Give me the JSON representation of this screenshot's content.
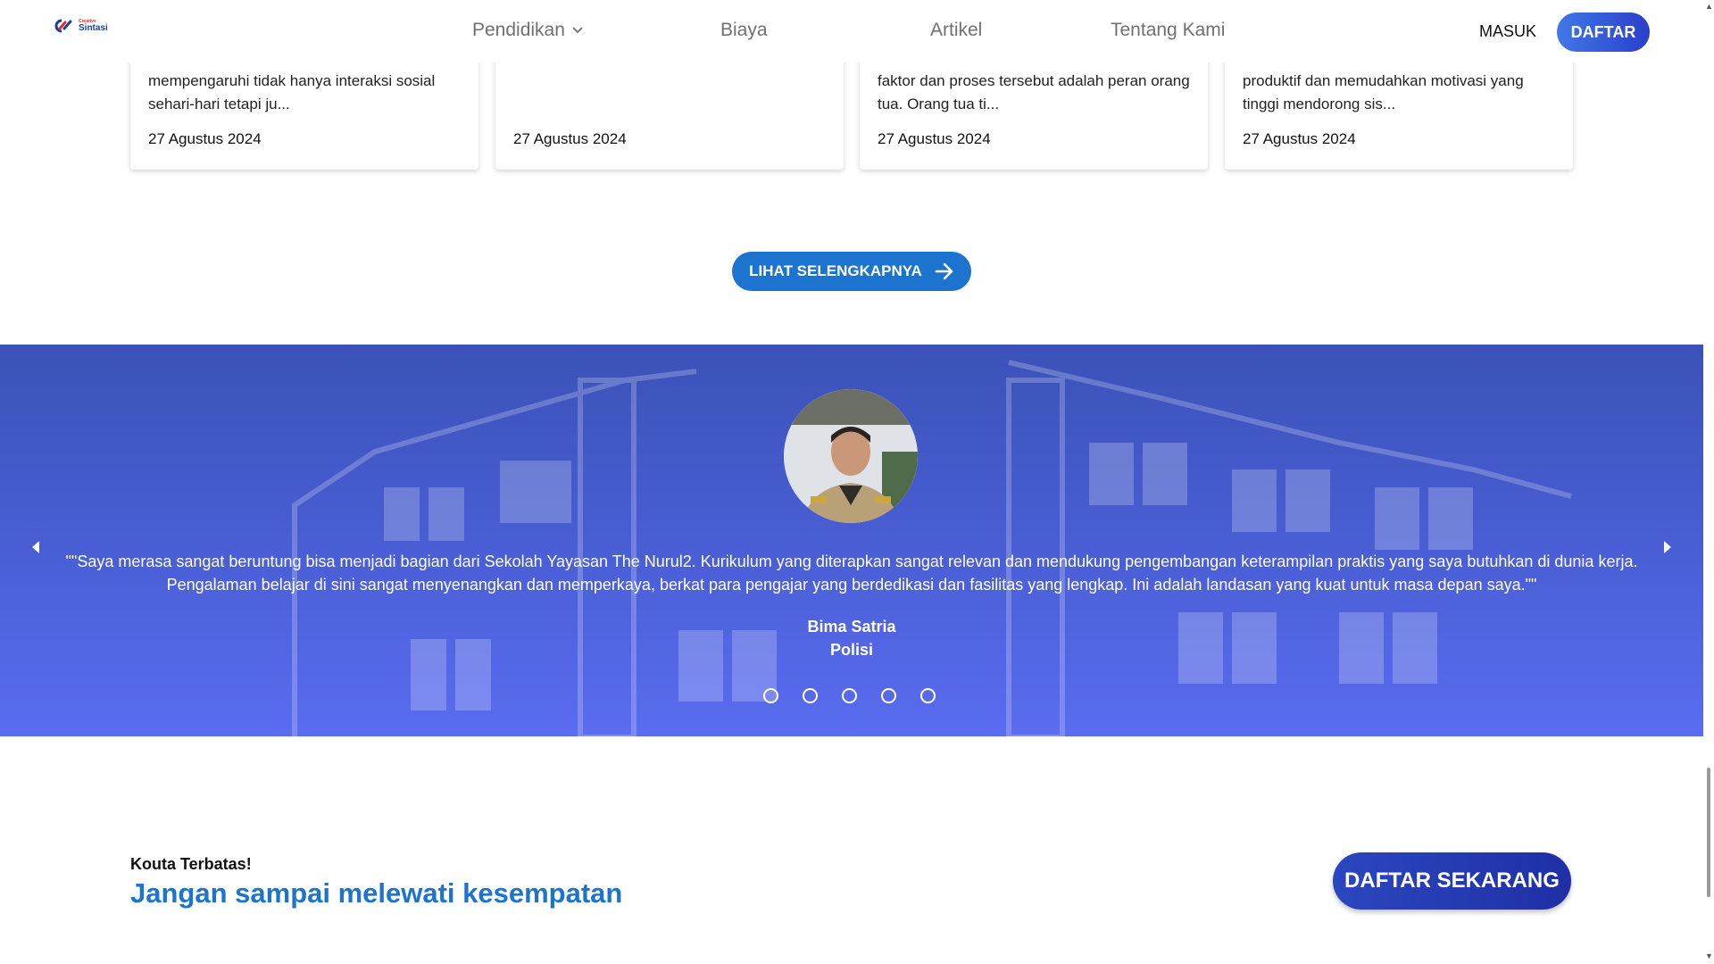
{
  "header": {
    "logo_small": "Creative",
    "logo_big": "Sintasi",
    "nav": [
      {
        "label": "Pendidikan",
        "has_dropdown": true
      },
      {
        "label": "Biaya"
      },
      {
        "label": "Artikel"
      },
      {
        "label": "Tentang Kami"
      }
    ],
    "masuk_label": "MASUK",
    "daftar_label": "DAFTAR"
  },
  "articles": [
    {
      "excerpt": "mempengaruhi tidak hanya interaksi sosial sehari-hari tetapi ju...",
      "date": "27 Agustus 2024"
    },
    {
      "excerpt": "",
      "date": "27 Agustus 2024"
    },
    {
      "excerpt": "faktor dan proses tersebut adalah peran orang tua. Orang tua ti...",
      "date": "27 Agustus 2024"
    },
    {
      "excerpt": "produktif dan memudahkan motivasi yang tinggi mendorong sis...",
      "date": "27 Agustus 2024"
    }
  ],
  "see_more_label": "LIHAT SELENGKAPNYA",
  "testimonial": {
    "quote_line1": "\"\"Saya merasa sangat beruntung bisa menjadi bagian dari Sekolah Yayasan The Nurul2. Kurikulum yang diterapkan sangat relevan dan mendukung pengembangan keterampilan praktis yang saya butuhkan di dunia kerja.",
    "quote_line2": "Pengalaman belajar di sini sangat menyenangkan dan memperkaya, berkat para pengajar yang berdedikasi dan fasilitas yang lengkap. Ini adalah landasan yang kuat untuk masa depan saya.\"\"",
    "name": "Bima Satria",
    "role": "Polisi",
    "slide_count": 5
  },
  "cta": {
    "small": "Kouta Terbatas!",
    "big": "Jangan sampai melewati kesempatan",
    "button": "DAFTAR SEKARANG"
  },
  "colors": {
    "primary": "#1c74cf",
    "daftar_gradient_start": "#3f78e8",
    "daftar_gradient_end": "#2c3fc9",
    "testimonial_bg": "#4a5fd6",
    "cta_button": "#2b47bf"
  }
}
